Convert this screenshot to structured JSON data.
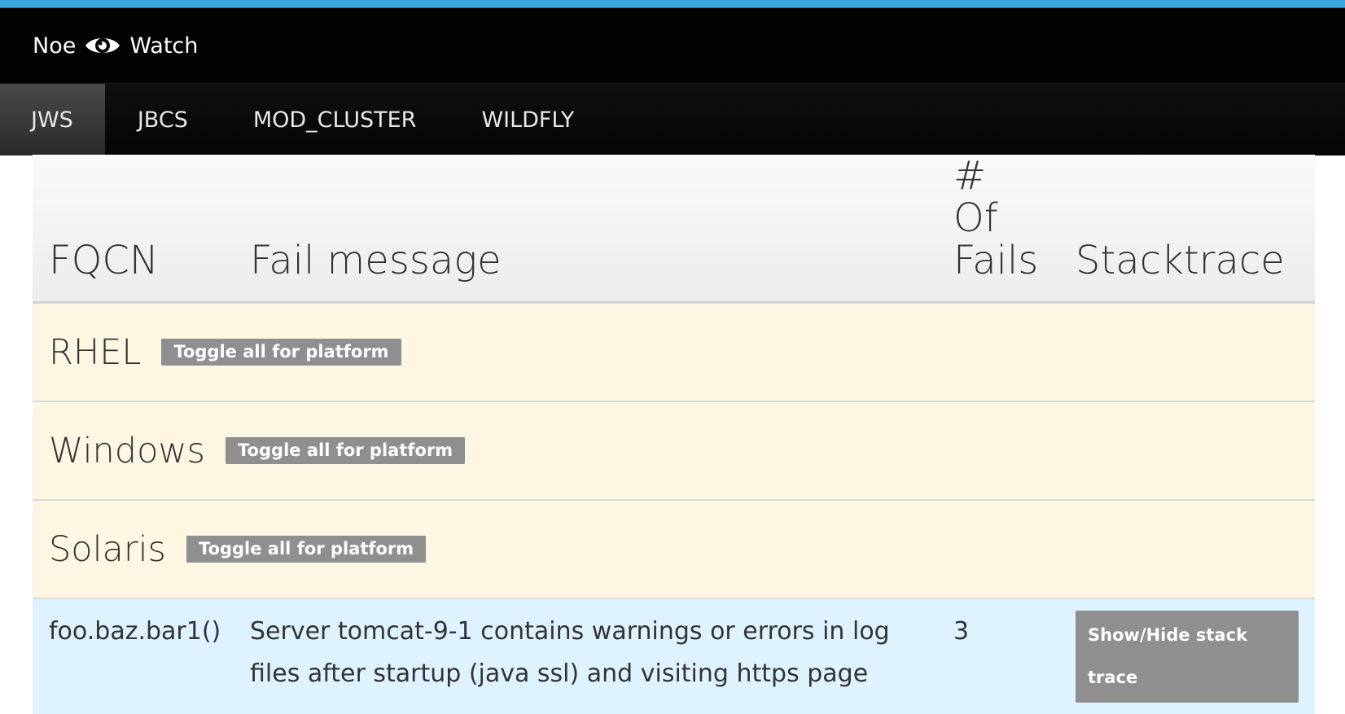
{
  "brand": {
    "name_left": "Noe",
    "name_right": "Watch",
    "logo_icon": "eye-icon"
  },
  "nav": {
    "items": [
      {
        "label": "JWS",
        "active": true
      },
      {
        "label": "JBCS",
        "active": false
      },
      {
        "label": "MOD_CLUSTER",
        "active": false
      },
      {
        "label": "WILDFLY",
        "active": false
      }
    ]
  },
  "table": {
    "headers": {
      "fqcn": "FQCN",
      "fail_message": "Fail message",
      "num_fails_line1": "# Of",
      "num_fails_line2": "Fails",
      "stacktrace": "Stacktrace"
    },
    "platforms": [
      {
        "name": "RHEL",
        "toggle_label": "Toggle all for platform"
      },
      {
        "name": "Windows",
        "toggle_label": "Toggle all for platform"
      },
      {
        "name": "Solaris",
        "toggle_label": "Toggle all for platform"
      }
    ],
    "rows": [
      {
        "fqcn": "foo.baz.bar1()",
        "fail_message": "Server tomcat-9-1 contains warnings or errors in log files after startup (java ssl) and visiting https page",
        "num_fails": "3",
        "stack_button": "Show/Hide stack trace"
      }
    ]
  },
  "colors": {
    "accent_top": "#39a5dc",
    "platform_row_bg": "#fcf6e3",
    "data_row_bg": "#def3ff",
    "button_bg": "#8f8f8f"
  }
}
